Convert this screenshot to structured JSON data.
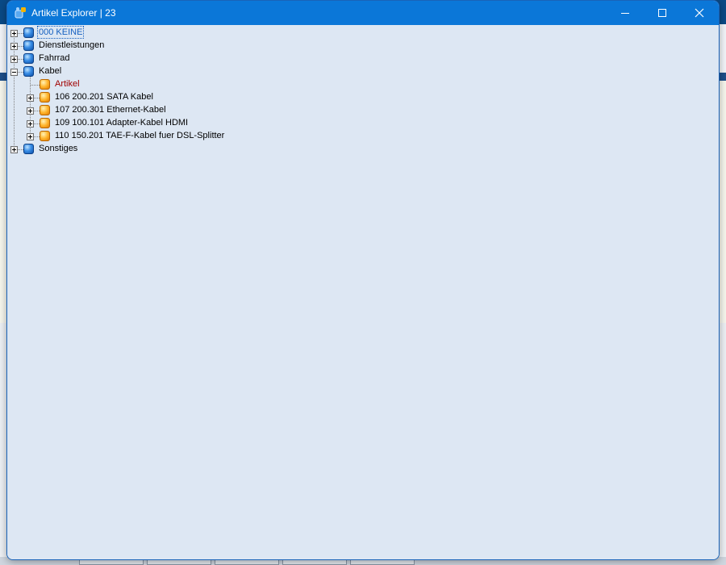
{
  "window": {
    "title": "Artikel Explorer | 23",
    "controls": {
      "minimize": "minimize",
      "maximize": "maximize",
      "close": "close"
    }
  },
  "tree": {
    "nodes": [
      {
        "label": "000 KEINE",
        "level": 0,
        "icon": "blue-cube-icon",
        "expanded": false,
        "selected": true
      },
      {
        "label": "Dienstleistungen",
        "level": 0,
        "icon": "blue-cube-icon",
        "expanded": false
      },
      {
        "label": "Fahrrad",
        "level": 0,
        "icon": "blue-cube-icon",
        "expanded": false
      },
      {
        "label": "Kabel",
        "level": 0,
        "icon": "blue-cube-icon",
        "expanded": true
      },
      {
        "label": "Artikel",
        "level": 1,
        "icon": "orange-cube-icon",
        "leaf": true,
        "color": "#a00000"
      },
      {
        "label": "106 200.201 SATA Kabel",
        "level": 1,
        "icon": "orange-cube-icon",
        "expanded": false
      },
      {
        "label": "107 200.301 Ethernet-Kabel",
        "level": 1,
        "icon": "orange-cube-icon",
        "expanded": false
      },
      {
        "label": "109 100.101 Adapter-Kabel HDMI",
        "level": 1,
        "icon": "orange-cube-icon",
        "expanded": false
      },
      {
        "label": "110 150.201 TAE-F-Kabel fuer DSL-Splitter",
        "level": 1,
        "icon": "orange-cube-icon",
        "expanded": false
      },
      {
        "label": "Sonstiges",
        "level": 0,
        "icon": "blue-cube-icon",
        "expanded": false
      }
    ]
  },
  "colors": {
    "titlebar": "#0b77d8",
    "client_background": "#dde7f3",
    "selected_text": "#1560c0",
    "highlight_text": "#a00000"
  }
}
